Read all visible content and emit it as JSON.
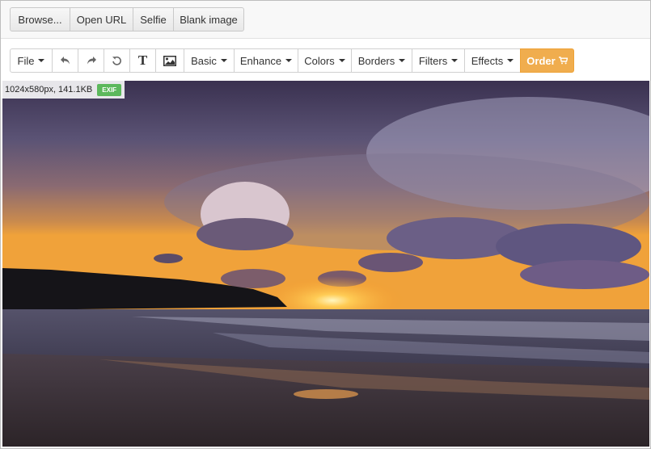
{
  "source_buttons": {
    "browse": "Browse...",
    "open_url": "Open URL",
    "selfie": "Selfie",
    "blank_image": "Blank image"
  },
  "toolbar": {
    "file": "File",
    "undo_icon": "undo-icon",
    "redo_icon": "redo-icon",
    "reset_icon": "reset-icon",
    "text_icon": "text-icon",
    "image_icon": "image-icon",
    "text_glyph": "T",
    "basic": "Basic",
    "enhance": "Enhance",
    "colors": "Colors",
    "borders": "Borders",
    "filters": "Filters",
    "effects": "Effects",
    "order": "Order",
    "order_icon": "cart-icon",
    "order_color": "#f0ad4e"
  },
  "image_info": {
    "dimensions": "1024x580px, 141.1KB",
    "exif_badge": "EXIF",
    "exif_color": "#5cb85c"
  }
}
